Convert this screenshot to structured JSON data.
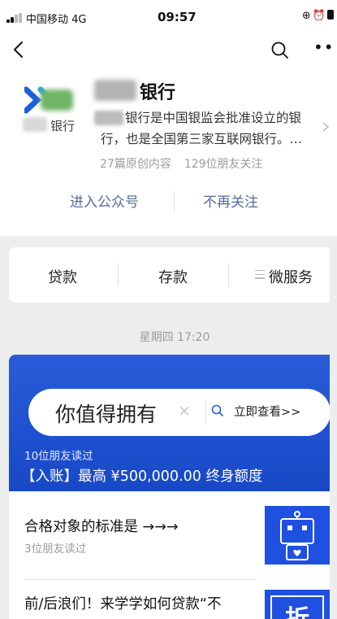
{
  "status_bar": {
    "carrier": "中国移动  4G",
    "time": "09:57",
    "icons": [
      "lock-rotation-icon",
      "alarm-icon",
      "battery-icon"
    ]
  },
  "nav": {
    "icons": [
      "back-icon",
      "search-icon",
      "more-icon"
    ]
  },
  "profile": {
    "logo_text": "银行",
    "name": "银行",
    "description_lines": [
      "银行是中国银监会批准设立的银",
      "行，也是全国第三家互联网银行。…"
    ],
    "stats": {
      "articles": "27篇原创内容",
      "followers": "129位朋友关注"
    },
    "actions": {
      "enter": "进入公众号",
      "unfollow": "不再关注"
    }
  },
  "menu": {
    "items": [
      "贷款",
      "存款",
      "微服务"
    ]
  },
  "timestamp": "星期四 17:20",
  "articles": {
    "main": {
      "banner_text": "你值得拥有",
      "banner_cta": "立即查看>>",
      "clear_symbol": "×",
      "reads": "10位朋友读过",
      "title": "【入账】最高 ¥500,000.00 终身额度"
    },
    "list": [
      {
        "title": "合格对象的标准是 →→→",
        "reads": "3位朋友读过"
      },
      {
        "title": "前/后浪们！来学学如何贷款“不"
      }
    ]
  },
  "colors": {
    "link": "#576b95",
    "banner": "#1e50d0",
    "thumb": "#2050e0"
  }
}
